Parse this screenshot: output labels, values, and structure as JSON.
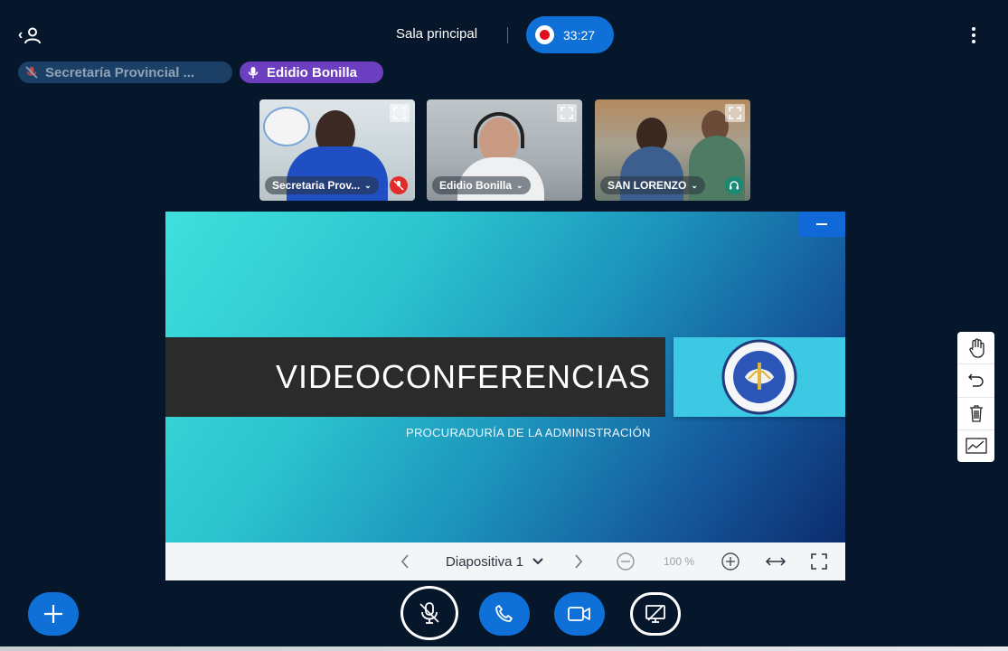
{
  "header": {
    "room_title": "Sala principal",
    "recording_time": "33:27",
    "recording_color": "#e00f1e"
  },
  "talkers": [
    {
      "name": "Secretaría Provincial ...",
      "muted": true
    },
    {
      "name": "Edidio Bonilla",
      "muted": false
    }
  ],
  "video_tiles": [
    {
      "name": "Secretaria Prov...",
      "status": "muted-icon"
    },
    {
      "name": "Edidio Bonilla",
      "status": ""
    },
    {
      "name": "SAN LORENZO",
      "status": "headset-icon"
    }
  ],
  "presentation": {
    "title": "VIDEOCONFERENCIAS",
    "subtitle": "PROCURADURÍA DE LA ADMINISTRACIÓN",
    "slide_label": "Diapositiva 1",
    "zoom": "100 %"
  },
  "whiteboard_tools": [
    "hand-icon",
    "undo-icon",
    "trash-icon",
    "chart-icon"
  ],
  "actions": [
    "add-icon",
    "mic-off-icon",
    "phone-icon",
    "camera-icon",
    "screenshare-off-icon"
  ],
  "colors": {
    "background": "#06172b",
    "primary": "#0f70d7",
    "talking_pill": "#6b3fbf"
  }
}
